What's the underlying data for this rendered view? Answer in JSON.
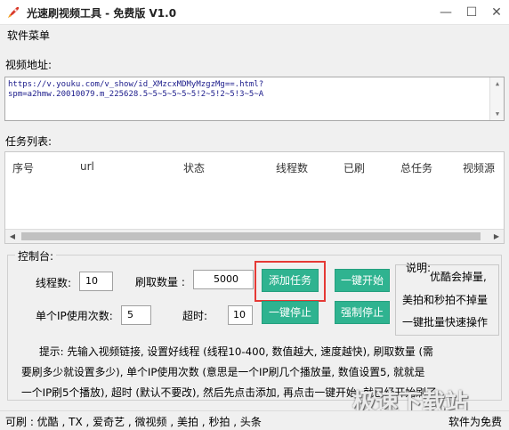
{
  "window": {
    "title": "光速刷视频工具 - 免费版 V1.0",
    "minimize": "—",
    "maximize": "☐",
    "close": "✕",
    "icon": "rocket-icon"
  },
  "menu": {
    "software_menu": "软件菜单"
  },
  "video_url": {
    "label": "视频地址:",
    "value_line1": "https://v.youku.com/v_show/id_XMzcxMDMyMzgzMg==.html?",
    "value_line2": "spm=a2hmw.20010079.m_225628.5~5~5~5~5~5!2~5!2~5!3~5~A"
  },
  "tasks": {
    "label": "任务列表:",
    "columns": [
      "序号",
      "url",
      "状态",
      "线程数",
      "已刷",
      "总任务",
      "视频源"
    ],
    "rows": []
  },
  "console": {
    "title": "控制台:",
    "threads_label": "线程数:",
    "threads_value": "10",
    "count_label": "刷取数量 :",
    "count_value": "5000",
    "per_ip_label": "单个IP使用次数:",
    "per_ip_value": "5",
    "timeout_label": "超时:",
    "timeout_value": "10",
    "add_task": "添加任务",
    "start_all": "一键开始",
    "stop_all": "一键停止",
    "force_stop": "强制停止"
  },
  "note": {
    "title": "说明:",
    "line1": "优酷会掉量,",
    "line2": "美拍和秒拍不掉量",
    "line3": "一键批量快速操作"
  },
  "tips": {
    "line1": "提示: 先输入视频链接, 设置好线程 (线程10-400, 数值越大, 速度越快), 刷取数量 (需",
    "line2": "要刷多少就设置多少), 单个IP使用次数 (意思是一个IP刷几个播放量, 数值设置5, 就就是",
    "line3": "一个IP刷5个播放), 超时 (默认不要改), 然后先点击添加, 再点击一键开始, 就已经开始刷了"
  },
  "status": {
    "left": "可刷 : 优酷 , TX , 爱奇艺 , 微视频 , 美拍 , 秒拍 , 头条",
    "right": "软件为免费"
  },
  "watermark": "极速下载站",
  "colors": {
    "button_green": "#2fb390",
    "highlight_red": "#e53935",
    "url_text": "#1a1a8a"
  }
}
